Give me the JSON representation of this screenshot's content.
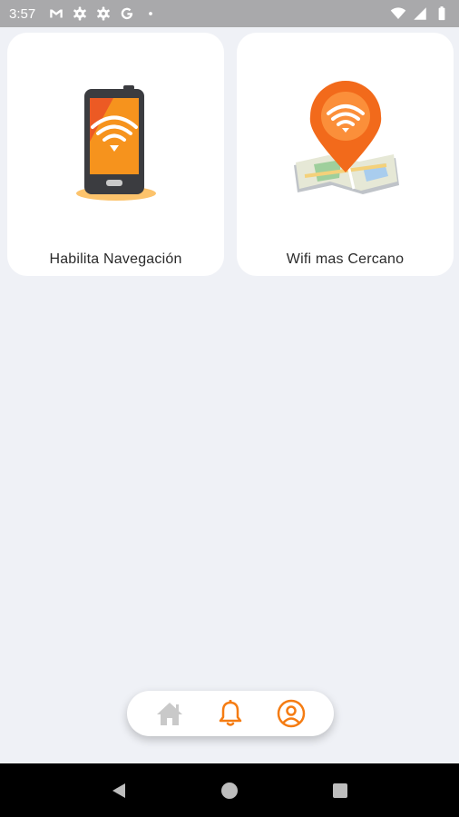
{
  "status_bar": {
    "time": "3:57",
    "left_icons": [
      "gmail-icon",
      "settings-icon",
      "settings-icon",
      "google-icon",
      "dot-icon"
    ],
    "right_icons": [
      "wifi-icon",
      "signal-icon",
      "battery-icon"
    ]
  },
  "cards": [
    {
      "label": "Habilita Navegación",
      "icon": "phone-wifi-icon"
    },
    {
      "label": "Wifi mas Cercano",
      "icon": "map-wifi-pin-icon"
    }
  ],
  "bottom_nav": {
    "items": [
      "home-icon",
      "bell-icon",
      "profile-icon"
    ],
    "colors": {
      "active": "#f57c12",
      "inactive": "#c9c9c9"
    }
  },
  "system_nav": [
    "back-icon",
    "home-circle-icon",
    "recents-icon"
  ],
  "colors": {
    "background": "#eff1f6",
    "accent": "#f57c12",
    "status_bar": "#a9a9ab"
  }
}
